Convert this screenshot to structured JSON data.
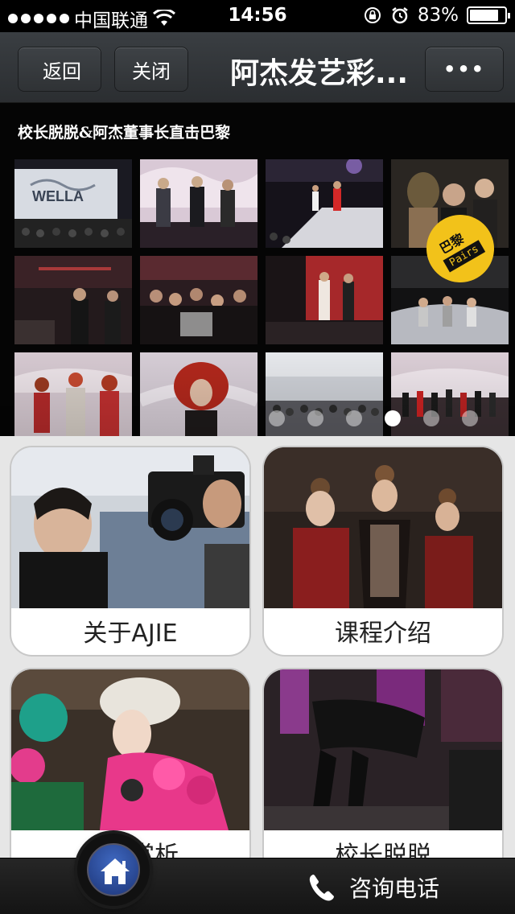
{
  "status_bar": {
    "carrier": "中国联通",
    "time": "14:56",
    "battery_percent": "83%",
    "battery_level": 0.83,
    "icons": [
      "signal-dots-icon",
      "wifi-icon",
      "orientation-lock-icon",
      "alarm-icon",
      "battery-icon"
    ]
  },
  "nav": {
    "back_label": "返回",
    "close_label": "关闭",
    "title": "阿杰发艺彩...",
    "more_label": "•••"
  },
  "banner": {
    "title": "校长脱脱&阿杰董事长直击巴黎",
    "badge_cn": "巴黎",
    "badge_en": "Pairs",
    "thumb_text": "WELLA",
    "slide_count": 6,
    "active_slide": 4
  },
  "cards": [
    {
      "label": "关于AJIE"
    },
    {
      "label": "课程介绍"
    },
    {
      "label": "作品赏析"
    },
    {
      "label": "校长脱脱"
    }
  ],
  "bottom": {
    "phone_label": "咨询电话"
  },
  "colors": {
    "nav_bg": "#2f3235",
    "badge": "#f2c21a",
    "home_button": "#2a4a9a"
  }
}
